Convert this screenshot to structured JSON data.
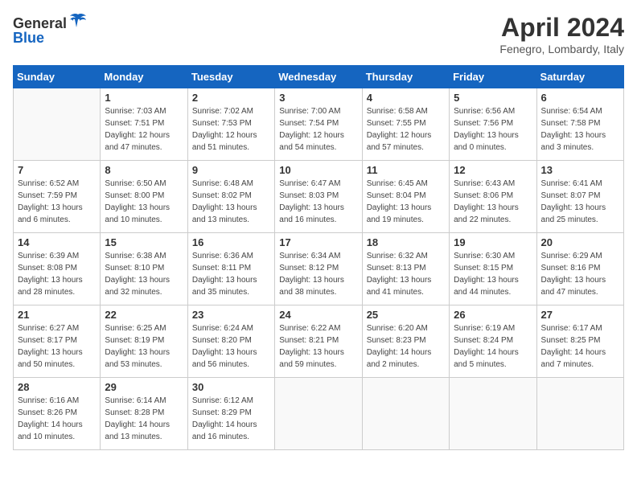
{
  "header": {
    "logo_general": "General",
    "logo_blue": "Blue",
    "title": "April 2024",
    "location": "Fenegro, Lombardy, Italy"
  },
  "days_of_week": [
    "Sunday",
    "Monday",
    "Tuesday",
    "Wednesday",
    "Thursday",
    "Friday",
    "Saturday"
  ],
  "weeks": [
    [
      {
        "day": "",
        "info": ""
      },
      {
        "day": "1",
        "info": "Sunrise: 7:03 AM\nSunset: 7:51 PM\nDaylight: 12 hours\nand 47 minutes."
      },
      {
        "day": "2",
        "info": "Sunrise: 7:02 AM\nSunset: 7:53 PM\nDaylight: 12 hours\nand 51 minutes."
      },
      {
        "day": "3",
        "info": "Sunrise: 7:00 AM\nSunset: 7:54 PM\nDaylight: 12 hours\nand 54 minutes."
      },
      {
        "day": "4",
        "info": "Sunrise: 6:58 AM\nSunset: 7:55 PM\nDaylight: 12 hours\nand 57 minutes."
      },
      {
        "day": "5",
        "info": "Sunrise: 6:56 AM\nSunset: 7:56 PM\nDaylight: 13 hours\nand 0 minutes."
      },
      {
        "day": "6",
        "info": "Sunrise: 6:54 AM\nSunset: 7:58 PM\nDaylight: 13 hours\nand 3 minutes."
      }
    ],
    [
      {
        "day": "7",
        "info": "Sunrise: 6:52 AM\nSunset: 7:59 PM\nDaylight: 13 hours\nand 6 minutes."
      },
      {
        "day": "8",
        "info": "Sunrise: 6:50 AM\nSunset: 8:00 PM\nDaylight: 13 hours\nand 10 minutes."
      },
      {
        "day": "9",
        "info": "Sunrise: 6:48 AM\nSunset: 8:02 PM\nDaylight: 13 hours\nand 13 minutes."
      },
      {
        "day": "10",
        "info": "Sunrise: 6:47 AM\nSunset: 8:03 PM\nDaylight: 13 hours\nand 16 minutes."
      },
      {
        "day": "11",
        "info": "Sunrise: 6:45 AM\nSunset: 8:04 PM\nDaylight: 13 hours\nand 19 minutes."
      },
      {
        "day": "12",
        "info": "Sunrise: 6:43 AM\nSunset: 8:06 PM\nDaylight: 13 hours\nand 22 minutes."
      },
      {
        "day": "13",
        "info": "Sunrise: 6:41 AM\nSunset: 8:07 PM\nDaylight: 13 hours\nand 25 minutes."
      }
    ],
    [
      {
        "day": "14",
        "info": "Sunrise: 6:39 AM\nSunset: 8:08 PM\nDaylight: 13 hours\nand 28 minutes."
      },
      {
        "day": "15",
        "info": "Sunrise: 6:38 AM\nSunset: 8:10 PM\nDaylight: 13 hours\nand 32 minutes."
      },
      {
        "day": "16",
        "info": "Sunrise: 6:36 AM\nSunset: 8:11 PM\nDaylight: 13 hours\nand 35 minutes."
      },
      {
        "day": "17",
        "info": "Sunrise: 6:34 AM\nSunset: 8:12 PM\nDaylight: 13 hours\nand 38 minutes."
      },
      {
        "day": "18",
        "info": "Sunrise: 6:32 AM\nSunset: 8:13 PM\nDaylight: 13 hours\nand 41 minutes."
      },
      {
        "day": "19",
        "info": "Sunrise: 6:30 AM\nSunset: 8:15 PM\nDaylight: 13 hours\nand 44 minutes."
      },
      {
        "day": "20",
        "info": "Sunrise: 6:29 AM\nSunset: 8:16 PM\nDaylight: 13 hours\nand 47 minutes."
      }
    ],
    [
      {
        "day": "21",
        "info": "Sunrise: 6:27 AM\nSunset: 8:17 PM\nDaylight: 13 hours\nand 50 minutes."
      },
      {
        "day": "22",
        "info": "Sunrise: 6:25 AM\nSunset: 8:19 PM\nDaylight: 13 hours\nand 53 minutes."
      },
      {
        "day": "23",
        "info": "Sunrise: 6:24 AM\nSunset: 8:20 PM\nDaylight: 13 hours\nand 56 minutes."
      },
      {
        "day": "24",
        "info": "Sunrise: 6:22 AM\nSunset: 8:21 PM\nDaylight: 13 hours\nand 59 minutes."
      },
      {
        "day": "25",
        "info": "Sunrise: 6:20 AM\nSunset: 8:23 PM\nDaylight: 14 hours\nand 2 minutes."
      },
      {
        "day": "26",
        "info": "Sunrise: 6:19 AM\nSunset: 8:24 PM\nDaylight: 14 hours\nand 5 minutes."
      },
      {
        "day": "27",
        "info": "Sunrise: 6:17 AM\nSunset: 8:25 PM\nDaylight: 14 hours\nand 7 minutes."
      }
    ],
    [
      {
        "day": "28",
        "info": "Sunrise: 6:16 AM\nSunset: 8:26 PM\nDaylight: 14 hours\nand 10 minutes."
      },
      {
        "day": "29",
        "info": "Sunrise: 6:14 AM\nSunset: 8:28 PM\nDaylight: 14 hours\nand 13 minutes."
      },
      {
        "day": "30",
        "info": "Sunrise: 6:12 AM\nSunset: 8:29 PM\nDaylight: 14 hours\nand 16 minutes."
      },
      {
        "day": "",
        "info": ""
      },
      {
        "day": "",
        "info": ""
      },
      {
        "day": "",
        "info": ""
      },
      {
        "day": "",
        "info": ""
      }
    ]
  ]
}
